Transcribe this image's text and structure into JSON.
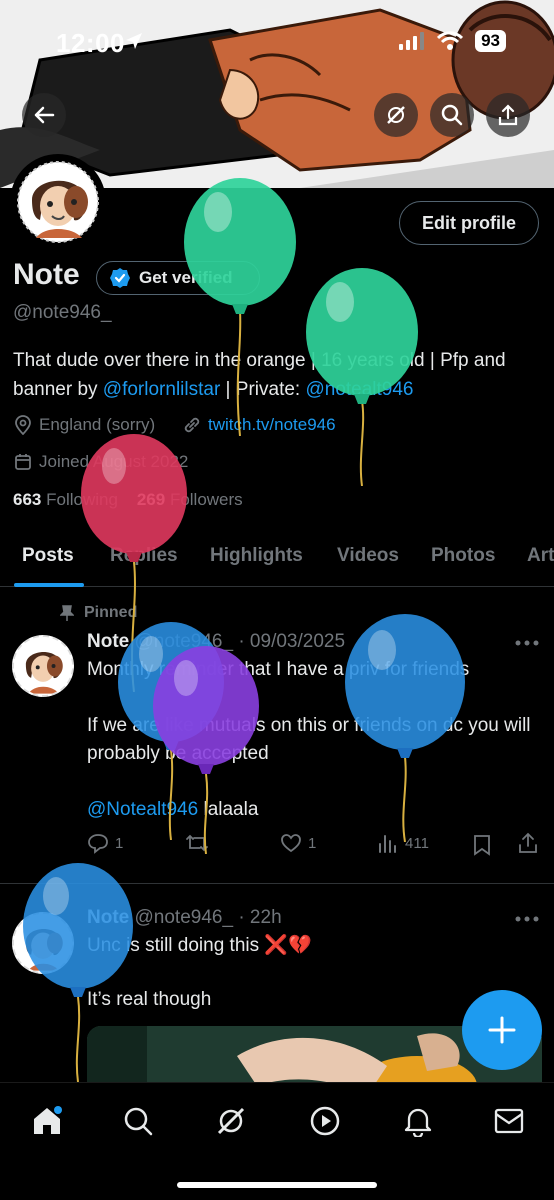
{
  "status_bar": {
    "time": "12:00",
    "battery": "93"
  },
  "profile": {
    "name": "Note",
    "verify_label": "Get verified",
    "handle": "@note946_",
    "edit_label": "Edit profile",
    "bio_text_1": "That dude over there in the orange | 16 years old | Pfp and banner by ",
    "bio_link_1": "@forlornlilstar",
    "bio_text_2": " | Private: ",
    "bio_link_2": "@notealt946",
    "location": "England (sorry)",
    "website": "twitch.tv/note946",
    "joined": "Joined August 2022",
    "following_count": "663",
    "following_label": "Following",
    "followers_count": "269",
    "followers_label": "Followers"
  },
  "tabs": [
    "Posts",
    "Replies",
    "Highlights",
    "Videos",
    "Photos",
    "Art"
  ],
  "posts": [
    {
      "pinned_label": "Pinned",
      "author": "Note",
      "handle_date": "@note946_ · 09/03/2025",
      "line1": "Monthly reminder that I have a priv for friends",
      "line2": "If we are like mutuals on this or friends on dc you will probably be accepted",
      "mention": "@Notealt946",
      "mention_tail": " lalaala",
      "replies": "1",
      "likes": "1",
      "views": "411"
    },
    {
      "author": "Note",
      "handle_date": "@note946_ · 22h",
      "line1": "Unc is still doing this ❌💔",
      "line2": "It’s real though"
    }
  ],
  "colors": {
    "accent": "#1d9bf0",
    "balloon_green": "#2fd39a",
    "balloon_red": "#e0385e",
    "balloon_blue": "#2a8fe3",
    "balloon_purple": "#8a3fe0"
  },
  "icons": [
    "back-arrow-icon",
    "grok-icon",
    "search-icon",
    "share-icon",
    "verified-badge-icon",
    "location-icon",
    "link-icon",
    "calendar-icon",
    "pin-icon",
    "more-icon",
    "reply-icon",
    "retweet-icon",
    "like-icon",
    "views-icon",
    "bookmark-icon",
    "plus-icon",
    "home-icon",
    "explore-icon",
    "play-icon",
    "bell-icon",
    "mail-icon"
  ]
}
